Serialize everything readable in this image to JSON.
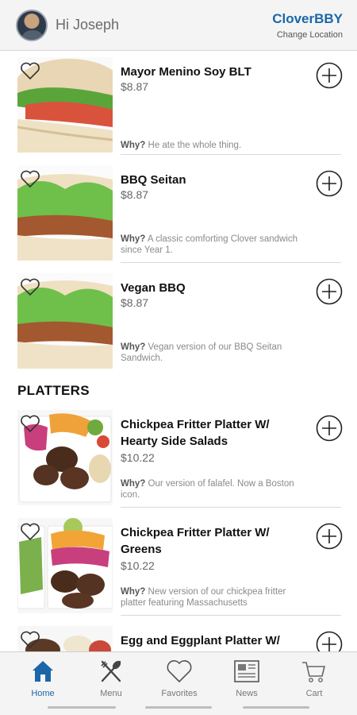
{
  "header": {
    "greeting": "Hi Joseph",
    "store_name": "CloverBBY",
    "change_location": "Change Location"
  },
  "colors": {
    "accent": "#1b66a8",
    "divider": "#d9d9d9"
  },
  "menu": {
    "sandwiches": [
      {
        "name": "Mayor Menino Soy BLT",
        "price": "$8.87",
        "why_label": "Why?",
        "why": "He ate the whole thing."
      },
      {
        "name": "BBQ Seitan",
        "price": "$8.87",
        "why_label": "Why?",
        "why": "A classic comforting Clover sandwich since Year 1."
      },
      {
        "name": "Vegan BBQ",
        "price": "$8.87",
        "why_label": "Why?",
        "why": "Vegan version of our BBQ Seitan Sandwich."
      }
    ],
    "platters_title": "PLATTERS",
    "platters": [
      {
        "name": "Chickpea Fritter Platter W/ Hearty Side Salads",
        "price": "$10.22",
        "why_label": "Why?",
        "why": "Our version of falafel. Now a Boston icon."
      },
      {
        "name": "Chickpea Fritter Platter W/ Greens",
        "price": "$10.22",
        "why_label": "Why?",
        "why": "New version of our chickpea fritter platter featuring Massachusetts"
      },
      {
        "name": "Egg and Eggplant Platter W/ Hearty Side Salads",
        "price": "",
        "why_label": "",
        "why": ""
      }
    ]
  },
  "nav": {
    "items": [
      {
        "label": "Home",
        "icon": "home-icon",
        "active": true
      },
      {
        "label": "Menu",
        "icon": "fork-knife-icon",
        "active": false
      },
      {
        "label": "Favorites",
        "icon": "heart-icon",
        "active": false
      },
      {
        "label": "News",
        "icon": "newspaper-icon",
        "active": false
      },
      {
        "label": "Cart",
        "icon": "cart-icon",
        "active": false
      }
    ]
  }
}
